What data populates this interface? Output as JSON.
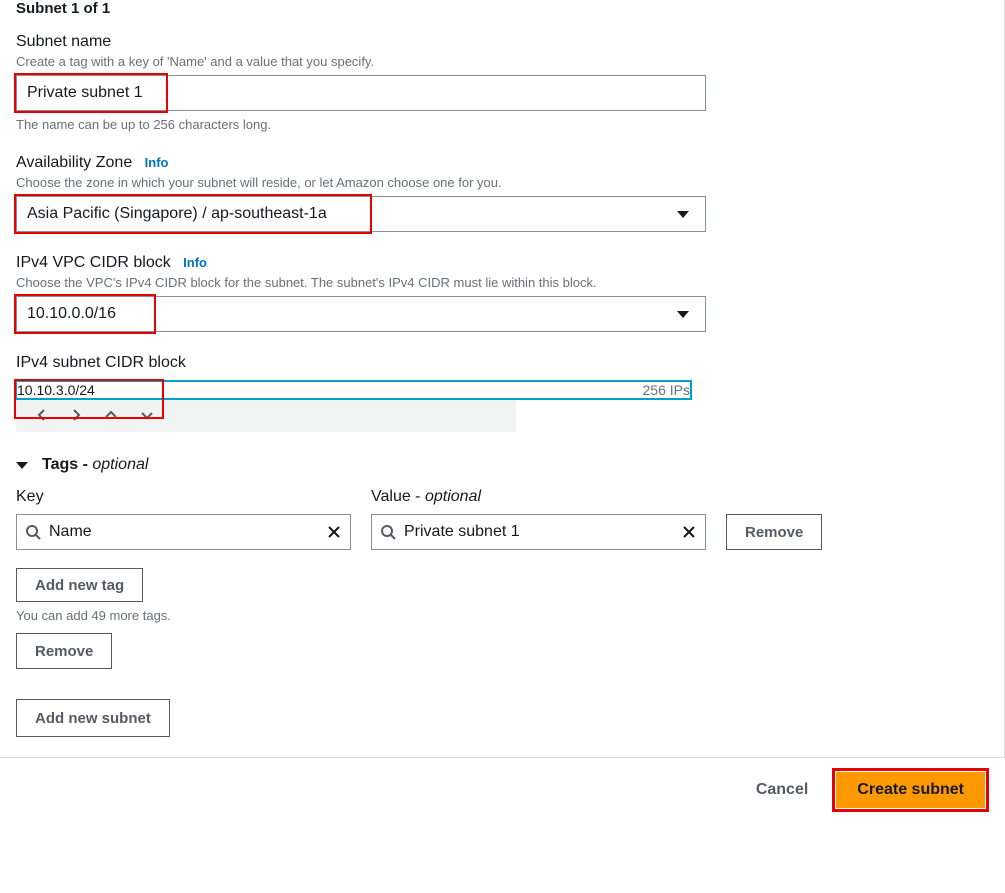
{
  "header": {
    "title": "Subnet 1 of 1"
  },
  "name_field": {
    "label": "Subnet name",
    "desc": "Create a tag with a key of 'Name' and a value that you specify.",
    "value": "Private subnet 1",
    "below": "The name can be up to 256 characters long."
  },
  "az_field": {
    "label": "Availability Zone",
    "info": "Info",
    "desc": "Choose the zone in which your subnet will reside, or let Amazon choose one for you.",
    "value": "Asia Pacific (Singapore) / ap-southeast-1a"
  },
  "vpc_cidr": {
    "label": "IPv4 VPC CIDR block",
    "info": "Info",
    "desc": "Choose the VPC's IPv4 CIDR block for the subnet. The subnet's IPv4 CIDR must lie within this block.",
    "value": "10.10.0.0/16"
  },
  "subnet_cidr": {
    "label": "IPv4 subnet CIDR block",
    "value": "10.10.3.0/24",
    "ip_count": "256 IPs"
  },
  "tags": {
    "title": "Tags - ",
    "optional": "optional",
    "key_label": "Key",
    "value_label": "Value - ",
    "value_optional": "optional",
    "row": {
      "key": "Name",
      "value": "Private subnet 1",
      "remove": "Remove"
    },
    "add_tag": "Add new tag",
    "limit_text": "You can add 49 more tags.",
    "remove_section": "Remove"
  },
  "add_subnet": "Add new subnet",
  "footer": {
    "cancel": "Cancel",
    "create": "Create subnet"
  }
}
